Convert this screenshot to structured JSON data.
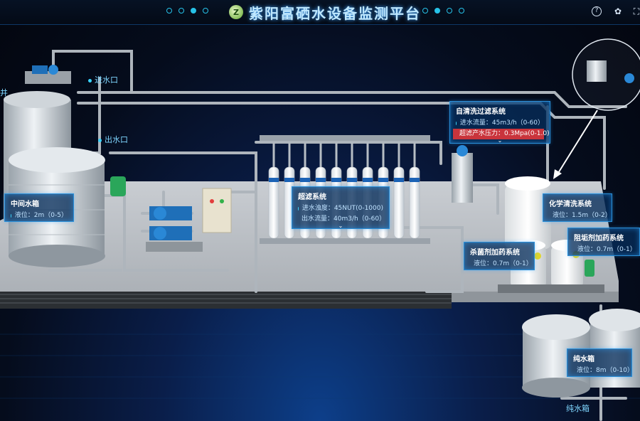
{
  "header": {
    "title": "紫阳富硒水设备监测平台",
    "logo_text": "Z"
  },
  "labels": {
    "well": "井",
    "inlet_1": "进水口",
    "outlet_1": "出水口",
    "pure_tank": "纯水箱"
  },
  "panels": {
    "middle_tank": {
      "title": "中间水箱",
      "rows": [
        "液位：2m（0-5）"
      ]
    },
    "self_clean": {
      "title": "自清洗过滤系统",
      "rows": [
        "进水流量：45m3/h（0-60）"
      ],
      "alarm": "超滤产水压力：0.3Mpa(0-1.0)"
    },
    "ultrafiltration": {
      "title": "超滤系统",
      "rows": [
        "进水浊度：45NUT(0-1000)",
        "出水流量：40m3/h（0-60）"
      ]
    },
    "chem_clean": {
      "title": "化学清洗系统",
      "rows": [
        "液位：1.5m（0-2）"
      ]
    },
    "scale_inhibitor": {
      "title": "阻垢剂加药系统",
      "rows": [
        "液位：0.7m（0-1）"
      ]
    },
    "sterilize": {
      "title": "杀菌剂加药系统",
      "rows": [
        "液位：0.7m（0-1）"
      ]
    },
    "pure_tank": {
      "title": "纯水箱",
      "rows": [
        "液位：8m（0-10）"
      ]
    }
  },
  "colors": {
    "accent": "#27c2e8",
    "alarm": "#c9343c",
    "panel_border": "#2a8fd8"
  }
}
